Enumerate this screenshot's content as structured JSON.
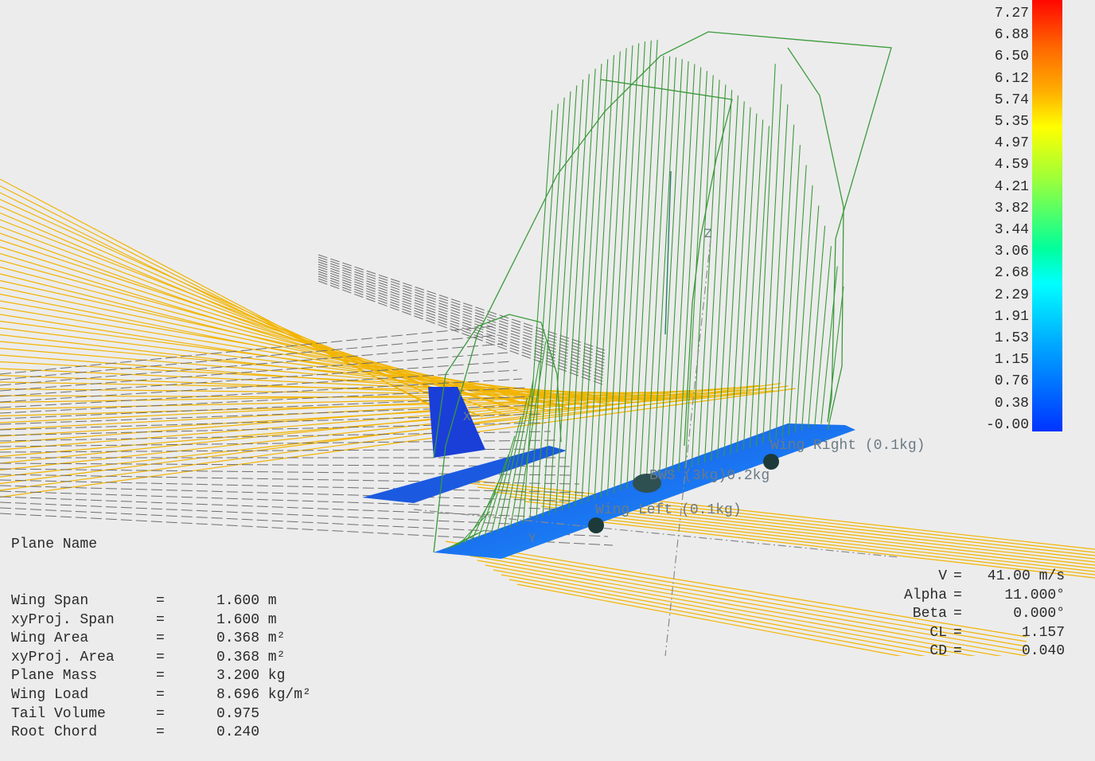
{
  "plane_info": {
    "title": "Plane Name",
    "rows": [
      {
        "label": "Wing Span",
        "eq": "=",
        "value": "1.600 m"
      },
      {
        "label": "xyProj. Span",
        "eq": "=",
        "value": "1.600 m"
      },
      {
        "label": "Wing Area",
        "eq": "=",
        "value": "0.368 m²"
      },
      {
        "label": "xyProj. Area",
        "eq": "=",
        "value": "0.368 m²"
      },
      {
        "label": "Plane Mass",
        "eq": "=",
        "value": "3.200 kg"
      },
      {
        "label": "Wing Load",
        "eq": "=",
        "value": "8.696 kg/m²"
      },
      {
        "label": "Tail Volume",
        "eq": "=",
        "value": "0.975"
      },
      {
        "label": "Root Chord",
        "eq": "=",
        "value": "0.240"
      }
    ]
  },
  "flight": [
    {
      "label": "V",
      "eq": "=",
      "value": "41.00 m/s"
    },
    {
      "label": "Alpha",
      "eq": "=",
      "value": "11.000°"
    },
    {
      "label": "Beta",
      "eq": "=",
      "value": "0.000°"
    },
    {
      "label": "CL",
      "eq": "=",
      "value": "1.157"
    },
    {
      "label": "CD",
      "eq": "=",
      "value": "0.040"
    }
  ],
  "legend": {
    "ticks": [
      "7.27",
      "6.88",
      "6.50",
      "6.12",
      "5.74",
      "5.35",
      "4.97",
      "4.59",
      "4.21",
      "3.82",
      "3.44",
      "3.06",
      "2.68",
      "2.29",
      "1.91",
      "1.53",
      "1.15",
      "0.76",
      "0.38",
      "-0.00"
    ],
    "colors": {
      "max": "#ff0000",
      "mid": "#ffff00",
      "cyan": "#00ffff",
      "min": "#0033ff"
    }
  },
  "scene_labels": {
    "wing_right": "Wing Right (0.1kg)",
    "wing_left": "Wing Left (0.1kg)",
    "mass": "BWS (3kg)0.2kg",
    "axis_z": "Z",
    "axis_y": "Y",
    "axis_x": "X"
  },
  "colors": {
    "streamlines": "#f2b400",
    "lift": "#3a9a3a",
    "wake": "#6e6e6e",
    "background": "#ececec"
  }
}
